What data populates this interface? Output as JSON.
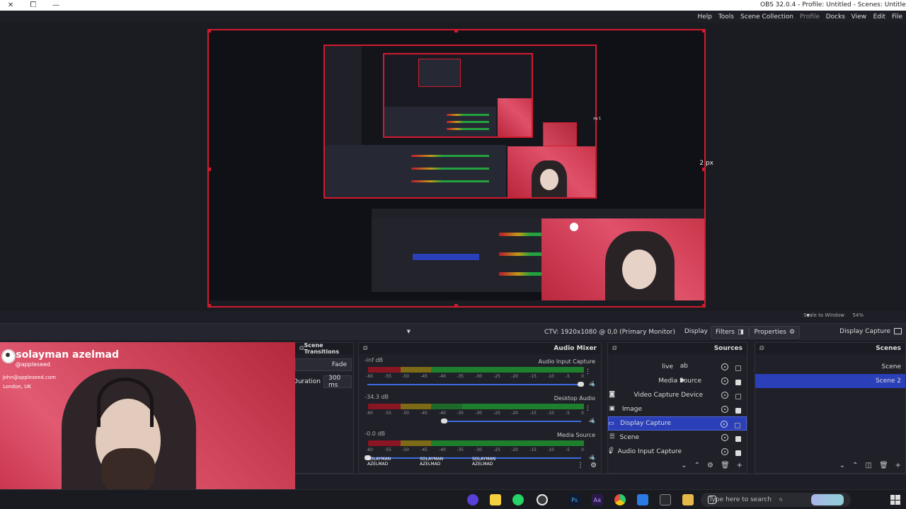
{
  "window": {
    "title": "OBS 32.0.4 - Profile: Untitled - Scenes: Untitled",
    "minimize_icon": "minimize-icon",
    "maximize_icon": "maximize-icon",
    "close_icon": "close-icon"
  },
  "menu": [
    "File",
    "Edit",
    "View",
    "Docks",
    "Profile",
    "Scene Collection",
    "Tools",
    "Help"
  ],
  "preview": {
    "px_left": "2 px",
    "px_right": "2 px",
    "nested_px": "2 px"
  },
  "toolbar": {
    "source_name": "Display Capture",
    "properties_label": "Properties",
    "filters_label": "Filters",
    "display_label": "Display",
    "display_value": "CTV: 1920x1080 @ 0,0 (Primary Monitor)",
    "scale_label": "Scale to Window",
    "zoom": "54%"
  },
  "scenes": {
    "title": "Scenes",
    "items": [
      "Scene",
      "Scene 2"
    ],
    "selected_index": 1
  },
  "sources": {
    "title": "Sources",
    "items": [
      {
        "name": "live",
        "icon": "text-icon",
        "locked": false
      },
      {
        "name": "Media Source",
        "icon": "play-icon",
        "locked": true
      },
      {
        "name": "Video Capture Device",
        "icon": "camera-icon",
        "locked": false
      },
      {
        "name": "Image",
        "icon": "image-icon",
        "locked": true
      },
      {
        "name": "Display Capture",
        "icon": "monitor-icon",
        "locked": false
      },
      {
        "name": "Scene",
        "icon": "list-icon",
        "locked": true
      },
      {
        "name": "Audio Input Capture",
        "icon": "mic-icon",
        "locked": true
      }
    ],
    "selected_index": 4
  },
  "mixer": {
    "title": "Audio Mixer",
    "channels": [
      {
        "name": "Audio Input Capture",
        "db": "-inf dB"
      },
      {
        "name": "Desktop Audio",
        "db": "-34.3 dB"
      },
      {
        "name": "Media Source",
        "db": "-0.0 dB"
      }
    ],
    "ticks": [
      "-60",
      "-55",
      "-50",
      "-45",
      "-40",
      "-35",
      "-30",
      "-25",
      "-20",
      "-15",
      "-10",
      "-5",
      "0"
    ]
  },
  "transitions": {
    "title": "Scene Transitions",
    "type": "Fade",
    "duration_label": "Duration",
    "duration_value": "300 ms"
  },
  "overlay": {
    "name": "solayman azelmad",
    "handle": "@appleseed",
    "email": "john@appleseed.com",
    "location": "London, UK",
    "social_handle": "SOLAYMAN AZELMAD",
    "social_handle2": "SOLAYMAN AZELMAD",
    "social_handle3": "SOLAYMAN AZELMAD"
  },
  "taskbar": {
    "search_placeholder": "Type here to search"
  },
  "colors": {
    "accent": "#2a3fb8",
    "selection_border": "#d21a2e"
  }
}
